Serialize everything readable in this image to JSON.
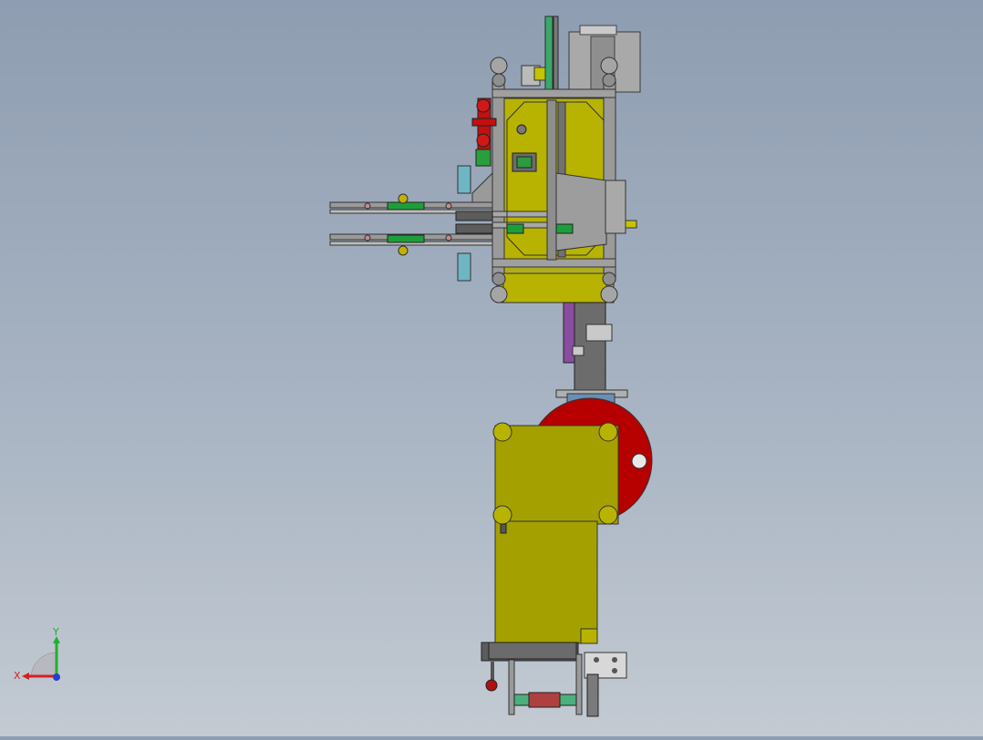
{
  "viewport": {
    "background_top": "#8e9db1",
    "background_bottom": "#c3cad2",
    "part_colors": {
      "frame_yellow": "#a4a000",
      "plate_yellow": "#b7b300",
      "disc_red": "#b60000",
      "steel_gray": "#9a9a9a",
      "dark_gray": "#5c5c5c",
      "accent_green": "#1e9e3a",
      "accent_cyan": "#6fb6c4",
      "accent_purple": "#8a4ca0",
      "accent_blue": "#6a8fb4"
    }
  },
  "triad": {
    "x_label": "X",
    "y_label": "Y",
    "x_color": "#d42020",
    "y_color": "#20b030",
    "z_color": "#2040d0"
  }
}
